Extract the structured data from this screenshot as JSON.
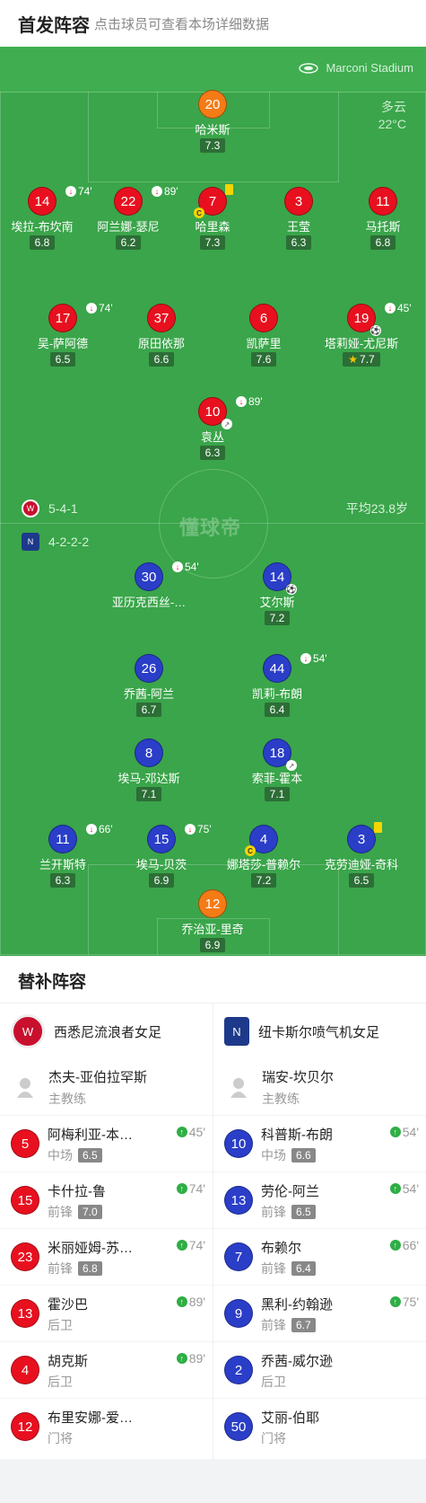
{
  "header": {
    "title": "首发阵容",
    "subtitle": "点击球员可查看本场详细数据"
  },
  "pitch": {
    "stadium": "Marconi Stadium",
    "weather": "多云",
    "temperature": "22°C",
    "watermark": "懂球帝",
    "home_formation": "5-4-1",
    "away_formation": "4-2-2-2",
    "average_age": "平均23.8岁"
  },
  "home_players": [
    {
      "num": "20",
      "name": "哈米斯",
      "rating": "7.3",
      "color": "#f47b16"
    },
    {
      "num": "14",
      "name": "埃拉-布坎南",
      "rating": "6.8",
      "sub": "74'"
    },
    {
      "num": "22",
      "name": "阿兰娜-瑟尼",
      "rating": "6.2",
      "sub": "89'"
    },
    {
      "num": "7",
      "name": "哈里森",
      "rating": "7.3",
      "captain": "C"
    },
    {
      "num": "3",
      "name": "王莹",
      "rating": "6.3"
    },
    {
      "num": "11",
      "name": "马托斯",
      "rating": "6.8"
    },
    {
      "num": "17",
      "name": "吴-萨阿德",
      "rating": "6.5",
      "sub": "74'"
    },
    {
      "num": "37",
      "name": "原田依那",
      "rating": "6.6"
    },
    {
      "num": "6",
      "name": "凯萨里",
      "rating": "7.6"
    },
    {
      "num": "19",
      "name": "塔莉娅-尤尼斯",
      "rating": "7.7",
      "sub": "45'"
    },
    {
      "num": "10",
      "name": "袁丛",
      "rating": "6.3",
      "sub": "89'"
    }
  ],
  "away_players": [
    {
      "num": "30",
      "name": "亚历克西丝-…",
      "rating": "",
      "sub": "54'"
    },
    {
      "num": "14",
      "name": "艾尔斯",
      "rating": "7.2"
    },
    {
      "num": "26",
      "name": "乔茜-阿兰",
      "rating": "6.7"
    },
    {
      "num": "44",
      "name": "凯莉-布朗",
      "rating": "6.4",
      "sub": "54'"
    },
    {
      "num": "8",
      "name": "埃马-邓达斯",
      "rating": "7.1"
    },
    {
      "num": "18",
      "name": "索菲-霍本",
      "rating": "7.1"
    },
    {
      "num": "11",
      "name": "兰开斯特",
      "rating": "6.3",
      "sub": "66'"
    },
    {
      "num": "15",
      "name": "埃马-贝茨",
      "rating": "6.9",
      "sub": "75'"
    },
    {
      "num": "4",
      "name": "娜塔莎-普赖尔",
      "rating": "7.2",
      "captain": "C"
    },
    {
      "num": "3",
      "name": "克劳迪娅-奇科",
      "rating": "6.5"
    },
    {
      "num": "12",
      "name": "乔治亚-里奇",
      "rating": "6.9",
      "color": "#f47b16"
    }
  ],
  "substitutes": {
    "title": "替补阵容",
    "home": {
      "team": "西悉尼流浪者女足",
      "coach": "杰夫-亚伯拉罕斯",
      "coach_role": "主教练",
      "players": [
        {
          "num": "5",
          "name": "阿梅利亚-本…",
          "pos": "中场",
          "rating": "6.5",
          "minute": "45'"
        },
        {
          "num": "15",
          "name": "卡什拉-鲁",
          "pos": "前锋",
          "rating": "7.0",
          "minute": "74'"
        },
        {
          "num": "23",
          "name": "米丽娅姆-苏…",
          "pos": "前锋",
          "rating": "6.8",
          "minute": "74'"
        },
        {
          "num": "13",
          "name": "霍沙巴",
          "pos": "后卫",
          "rating": "",
          "minute": "89'"
        },
        {
          "num": "4",
          "name": "胡克斯",
          "pos": "后卫",
          "rating": "",
          "minute": "89'"
        },
        {
          "num": "12",
          "name": "布里安娜-爱…",
          "pos": "门将",
          "rating": "",
          "minute": ""
        }
      ]
    },
    "away": {
      "team": "纽卡斯尔喷气机女足",
      "coach": "瑞安-坎贝尔",
      "coach_role": "主教练",
      "players": [
        {
          "num": "10",
          "name": "科普斯-布朗",
          "pos": "中场",
          "rating": "6.6",
          "minute": "54'"
        },
        {
          "num": "13",
          "name": "劳伦-阿兰",
          "pos": "前锋",
          "rating": "6.5",
          "minute": "54'"
        },
        {
          "num": "7",
          "name": "布赖尔",
          "pos": "前锋",
          "rating": "6.4",
          "minute": "66'"
        },
        {
          "num": "9",
          "name": "黑利-约翰逊",
          "pos": "前锋",
          "rating": "6.7",
          "minute": "75'"
        },
        {
          "num": "2",
          "name": "乔茜-威尔逊",
          "pos": "后卫",
          "rating": "",
          "minute": ""
        },
        {
          "num": "50",
          "name": "艾丽-伯耶",
          "pos": "门将",
          "rating": "",
          "minute": ""
        }
      ]
    }
  }
}
